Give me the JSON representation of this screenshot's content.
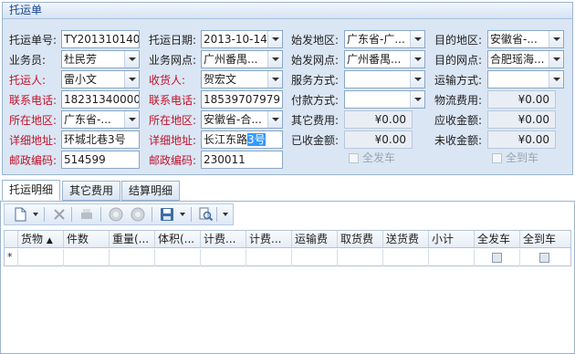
{
  "panel": {
    "title": "托运单"
  },
  "form": {
    "col1": [
      {
        "label": "托运单号:",
        "value": "TY201310140"
      },
      {
        "label": "业务员:",
        "value": "杜民芳"
      },
      {
        "label": "托运人:",
        "value": "雷小文"
      },
      {
        "label": "联系电话:",
        "value": "18231340000"
      },
      {
        "label": "所在地区:",
        "value": "广东省-..."
      },
      {
        "label": "详细地址:",
        "value": "环城北巷3号"
      },
      {
        "label": "邮政编码:",
        "value": "514599"
      }
    ],
    "col2": [
      {
        "label": "托运日期:",
        "value": "2013-10-14"
      },
      {
        "label": "业务网点:",
        "value": "广州番禺..."
      },
      {
        "label": "收货人:",
        "value": "贺宏文"
      },
      {
        "label": "联系电话:",
        "value": "18539707979"
      },
      {
        "label": "所在地区:",
        "value": "安徽省-合..."
      },
      {
        "label": "详细地址:",
        "value": "长江东路",
        "value_selected": "3号"
      },
      {
        "label": "邮政编码:",
        "value": "230011"
      }
    ],
    "col3": [
      {
        "label": "始发地区:",
        "value": "广东省-广..."
      },
      {
        "label": "始发网点:",
        "value": "广州番禺..."
      },
      {
        "label": "服务方式:",
        "value": ""
      },
      {
        "label": "付款方式:",
        "value": ""
      },
      {
        "label": "其它费用:",
        "value": "¥0.00"
      },
      {
        "label": "已收金额:",
        "value": "¥0.00"
      }
    ],
    "col4": [
      {
        "label": "目的地区:",
        "value": "安徽省-..."
      },
      {
        "label": "目的网点:",
        "value": "合肥瑶海..."
      },
      {
        "label": "运输方式:",
        "value": ""
      },
      {
        "label": "物流费用:",
        "value": "¥0.00"
      },
      {
        "label": "应收金额:",
        "value": "¥0.00"
      },
      {
        "label": "未收金额:",
        "value": "¥0.00"
      }
    ],
    "check_all_shipped": "全发车",
    "check_all_arrived": "全到车"
  },
  "tabs": [
    "托运明细",
    "其它费用",
    "结算明细"
  ],
  "grid": {
    "columns": [
      "货物",
      "件数",
      "重量(...",
      "体积(...",
      "计费...",
      "计费...",
      "运输费",
      "取货费",
      "送货费",
      "小计",
      "全发车",
      "全到车"
    ],
    "new_row_marker": "*"
  },
  "colors": {
    "accent": "#15428b",
    "required_label": "#c0122b",
    "border": "#99b4d1"
  }
}
